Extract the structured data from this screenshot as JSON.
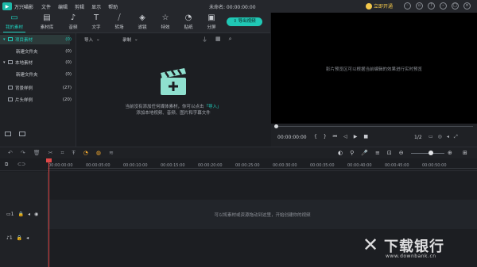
{
  "app": {
    "title": "万兴喵影",
    "project_title": "未命名: 00:00:00:00",
    "menu": [
      "文件",
      "编辑",
      "剪辑",
      "显示",
      "帮助"
    ],
    "vip_label": "立即开通"
  },
  "media_tabs": [
    {
      "label": "我的素材",
      "icon": "folder-icon",
      "active": true
    },
    {
      "label": "素材库",
      "icon": "library-icon"
    },
    {
      "label": "音频",
      "icon": "music-icon"
    },
    {
      "label": "文字",
      "icon": "text-icon"
    },
    {
      "label": "转场",
      "icon": "transition-icon"
    },
    {
      "label": "滤镜",
      "icon": "filter-icon"
    },
    {
      "label": "特效",
      "icon": "effect-icon"
    },
    {
      "label": "贴纸",
      "icon": "sticker-icon"
    },
    {
      "label": "分屏",
      "icon": "split-screen-icon"
    }
  ],
  "export_label": "导出视频",
  "library": {
    "items": [
      {
        "label": "项目素材",
        "count": "(0)",
        "selected": true
      },
      {
        "label": "新建文件夹",
        "count": "(0)"
      },
      {
        "label": "本地素材",
        "count": "(0)"
      },
      {
        "label": "新建文件夹",
        "count": "(0)"
      },
      {
        "label": "背景样例",
        "count": "(27)"
      },
      {
        "label": "片头样例",
        "count": "(20)"
      }
    ]
  },
  "media": {
    "import_label": "导入",
    "record_label": "录制",
    "empty_line1_pre": "当前没有添加任何媒体素材，你可以点击",
    "empty_line1_link": "「导入」",
    "empty_line2": "添加本地视频、音频、图片和字幕文件"
  },
  "preview": {
    "hint": "影片预览区可以根据当前编辑的效果进行实时预览",
    "timecode": "00:00:00:00",
    "ratio": "1/2"
  },
  "ruler_ticks": [
    "00:00:00:00",
    "00:00:05:00",
    "00:00:10:00",
    "00:00:15:00",
    "00:00:20:00",
    "00:00:25:00",
    "00:00:30:00",
    "00:00:35:00",
    "00:00:40:00",
    "00:00:45:00",
    "00:00:50:00"
  ],
  "tracks": {
    "video_hint": "可以将素材或资源拖动到这里，开始创建你的视频",
    "video_label": "1",
    "audio_label": "1"
  },
  "watermark": {
    "text": "下载银行",
    "url": "www.downbank.cn"
  }
}
